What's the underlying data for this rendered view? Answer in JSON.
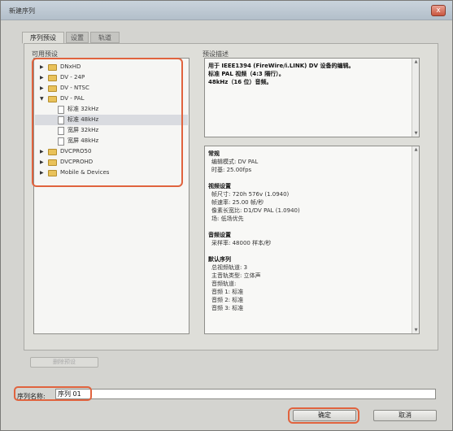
{
  "window": {
    "title": "新建序列",
    "close_glyph": "x"
  },
  "tabs": [
    {
      "label": "序列预设",
      "active": true
    },
    {
      "label": "设置",
      "active": false
    },
    {
      "label": "轨道",
      "active": false
    }
  ],
  "presets": {
    "section_label": "可用预设",
    "items": [
      {
        "label": "DNxHD",
        "type": "folder",
        "expanded": false,
        "level": 0
      },
      {
        "label": "DV - 24P",
        "type": "folder",
        "expanded": false,
        "level": 0
      },
      {
        "label": "DV - NTSC",
        "type": "folder",
        "expanded": false,
        "level": 0
      },
      {
        "label": "DV - PAL",
        "type": "folder",
        "expanded": true,
        "level": 0
      },
      {
        "label": "标准 32kHz",
        "type": "file",
        "level": 1
      },
      {
        "label": "标准 48kHz",
        "type": "file",
        "level": 1,
        "selected": true
      },
      {
        "label": "宽屏 32kHz",
        "type": "file",
        "level": 1
      },
      {
        "label": "宽屏 48kHz",
        "type": "file",
        "level": 1
      },
      {
        "label": "DVCPRO50",
        "type": "folder",
        "expanded": false,
        "level": 0
      },
      {
        "label": "DVCPROHD",
        "type": "folder",
        "expanded": false,
        "level": 0
      },
      {
        "label": "Mobile & Devices",
        "type": "folder",
        "expanded": false,
        "level": 0
      }
    ],
    "new_folder_label": "删除预设"
  },
  "description": {
    "section_label": "预设描述",
    "lines": [
      "用于 IEEE1394 (FireWire/i.LINK) DV 设备的编辑。",
      "标准 PAL 视频（4:3 隔行）。",
      "48kHz（16 位）音频。"
    ]
  },
  "details": {
    "lines": [
      {
        "text": "常规",
        "bold": true
      },
      {
        "text": "编辑模式: DV PAL",
        "bold": false
      },
      {
        "text": "时基: 25.00fps",
        "bold": false
      },
      {
        "text": "",
        "bold": false
      },
      {
        "text": "视频设置",
        "bold": true
      },
      {
        "text": "帧尺寸: 720h 576v (1.0940)",
        "bold": false
      },
      {
        "text": "帧速率: 25.00 帧/秒",
        "bold": false
      },
      {
        "text": "像素长宽比: D1/DV PAL (1.0940)",
        "bold": false
      },
      {
        "text": "场: 低场优先",
        "bold": false
      },
      {
        "text": "",
        "bold": false
      },
      {
        "text": "音频设置",
        "bold": true
      },
      {
        "text": "采样率: 48000 样本/秒",
        "bold": false
      },
      {
        "text": "",
        "bold": false
      },
      {
        "text": "默认序列",
        "bold": true
      },
      {
        "text": "总视频轨道: 3",
        "bold": false
      },
      {
        "text": "主音轨类型: 立体声",
        "bold": false
      },
      {
        "text": "音频轨道:",
        "bold": false
      },
      {
        "text": "音频 1: 标准",
        "bold": false
      },
      {
        "text": "音频 2: 标准",
        "bold": false
      },
      {
        "text": "音频 3: 标准",
        "bold": false
      }
    ]
  },
  "sequence_name": {
    "label": "序列名称:",
    "value": "序列 01"
  },
  "buttons": {
    "ok": "确定",
    "cancel": "取消"
  }
}
